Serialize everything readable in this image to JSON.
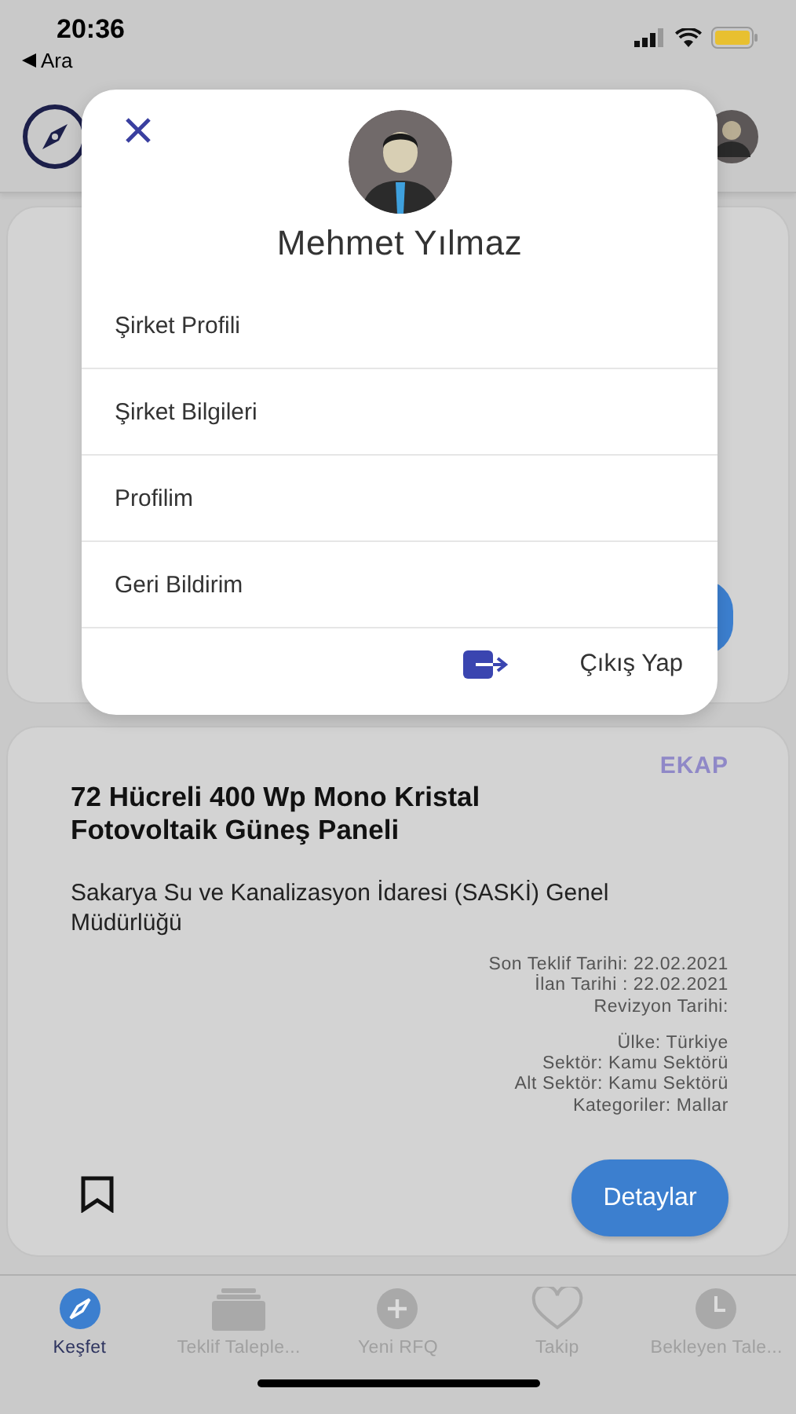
{
  "status_bar": {
    "time": "20:36",
    "back_label": "Ara"
  },
  "card": {
    "source": "EKAP",
    "title": "72 Hücreli 400 Wp Mono Kristal Fotovoltaik Güneş Paneli",
    "issuer": "Sakarya Su ve Kanalizasyon İdaresi (SASKİ) Genel Müdürlüğü",
    "dates": [
      "Son Teklif Tarihi:  22.02.2021",
      "İlan Tarihi :  22.02.2021",
      "Revizyon Tarihi:"
    ],
    "details": [
      "Ülke: Türkiye",
      "Sektör: Kamu Sektörü",
      "Alt Sektör: Kamu Sektörü",
      "Kategoriler: Mallar"
    ],
    "bookmarked": false,
    "button": "Detaylar"
  },
  "profile_menu": {
    "name": "Mehmet Yılmaz",
    "items": [
      "Şirket Profili",
      "Şirket Bilgileri",
      "Profilim",
      "Geri Bildirim"
    ],
    "logout": "Çıkış Yap"
  },
  "tab_bar": [
    {
      "label": "Keşfet",
      "kind": "compass",
      "selected": true
    },
    {
      "label": "Teklif Taleple...",
      "kind": "stack",
      "selected": false
    },
    {
      "label": "Yeni RFQ",
      "kind": "plus",
      "selected": false
    },
    {
      "label": "Takip",
      "kind": "heart",
      "selected": false
    },
    {
      "label": "Bekleyen Tale...",
      "kind": "clock",
      "selected": false
    }
  ]
}
